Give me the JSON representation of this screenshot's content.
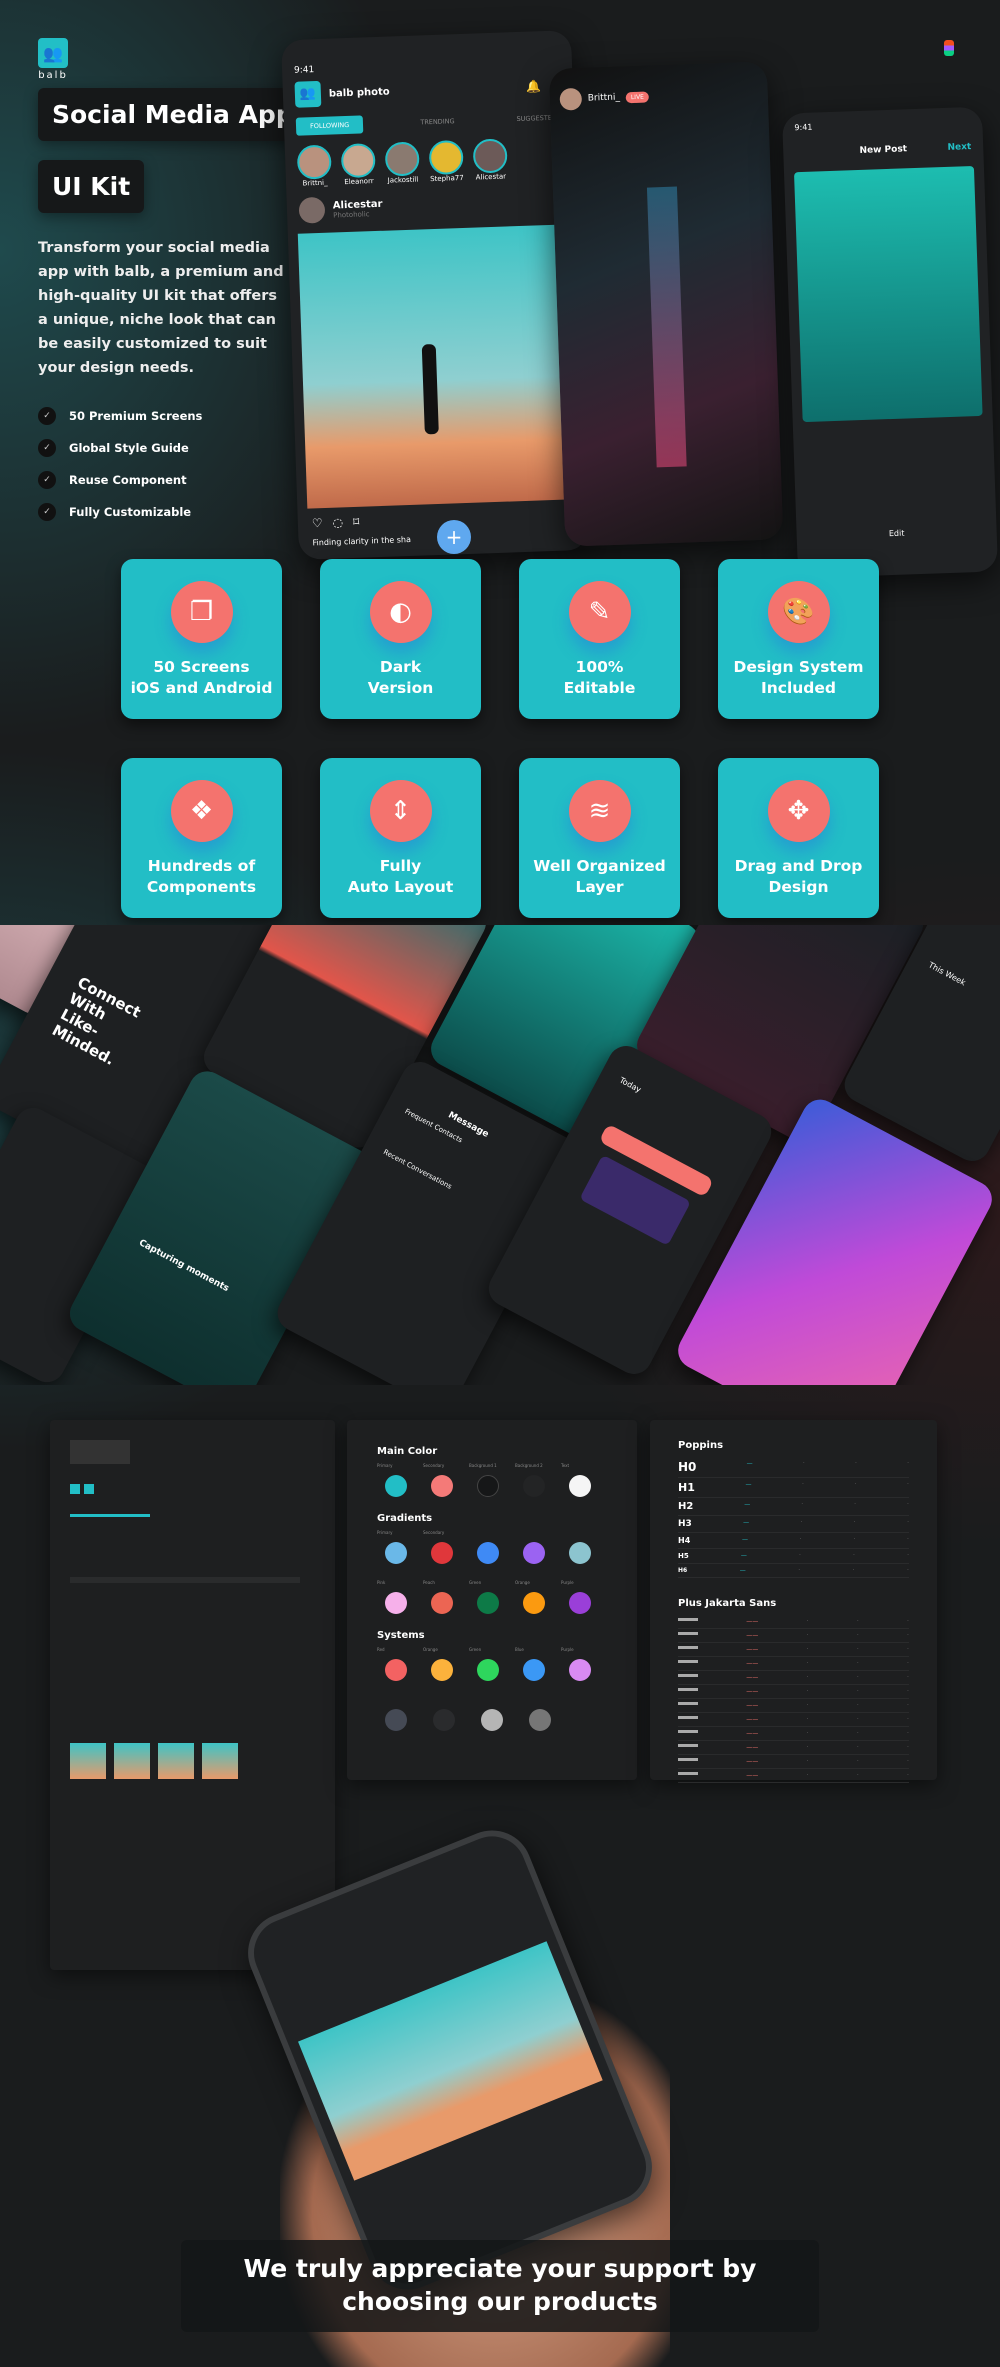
{
  "brand": {
    "name": "balb",
    "accent": "#22bec6",
    "secondary": "#f4736e"
  },
  "hero": {
    "title_line1": "Social Media App",
    "title_line2": "UI Kit",
    "description": "Transform your social media app with balb, a premium and high-quality UI kit that offers a unique, niche look that can be easily customized to suit your design needs.",
    "checklist": [
      "50 Premium Screens",
      "Global Style Guide",
      "Reuse Component",
      "Fully Customizable"
    ]
  },
  "phone_feed": {
    "time": "9:41",
    "app_name": "balb photo",
    "tabs": [
      "FOLLOWING",
      "TRENDING",
      "SUGGESTED"
    ],
    "stories": [
      "Brittni_",
      "Eleanorr",
      "Jackostill",
      "Stepha77",
      "Alicestar"
    ],
    "post_user": "Alicestar",
    "post_subtitle": "Photoholic",
    "caption": "Finding clarity in the sha"
  },
  "phone_live": {
    "user": "Brittni_",
    "live": "LIVE"
  },
  "phone_post": {
    "time": "9:41",
    "title": "New Post",
    "next": "Next",
    "edit": "Edit"
  },
  "features": [
    {
      "icon": "copy-icon",
      "label1": "50 Screens",
      "label2": "iOS and Android"
    },
    {
      "icon": "contrast-icon",
      "label1": "Dark",
      "label2": "Version"
    },
    {
      "icon": "edit-icon",
      "label1": "100%",
      "label2": "Editable"
    },
    {
      "icon": "palette-icon",
      "label1": "Design System",
      "label2": "Included"
    },
    {
      "icon": "components-icon",
      "label1": "Hundreds of",
      "label2": "Components"
    },
    {
      "icon": "auto-layout-icon",
      "label1": "Fully",
      "label2": "Auto Layout"
    },
    {
      "icon": "layers-icon",
      "label1": "Well Organized",
      "label2": "Layer"
    },
    {
      "icon": "move-icon",
      "label1": "Drag and Drop",
      "label2": "Design"
    }
  ],
  "collage": {
    "onboarding": "Connect With Like-Minded.",
    "camera_caption": "Capturing moments",
    "message_title": "Message",
    "frequent": "Frequent Contacts",
    "recent": "Recent Conversations",
    "today": "Today",
    "this_week": "This Week"
  },
  "style_guide": {
    "main_color": {
      "title": "Main Color",
      "swatches": [
        {
          "name": "Primary",
          "color": "#22bec6"
        },
        {
          "name": "Secondary",
          "color": "#f47a78"
        },
        {
          "name": "Background 1",
          "color": "#161718"
        },
        {
          "name": "Background 2",
          "color": "#232425"
        },
        {
          "name": "Text",
          "color": "#f5f5f5"
        }
      ]
    },
    "gradients": {
      "title": "Gradients",
      "swatches": [
        {
          "name": "Primary",
          "color": "#6ab8e8"
        },
        {
          "name": "Secondary",
          "color": "#e0373b"
        },
        {
          "name": "",
          "color": "#3f8af5"
        },
        {
          "name": "",
          "color": "#9b63f2"
        },
        {
          "name": "",
          "color": "#8cc4cf"
        },
        {
          "name": "Pink",
          "color": "#f6b0ea"
        },
        {
          "name": "Peach",
          "color": "#ec6553"
        },
        {
          "name": "Green",
          "color": "#0d7a47"
        },
        {
          "name": "Orange",
          "color": "#fb9a10"
        },
        {
          "name": "Purple",
          "color": "#9a3fd8"
        }
      ]
    },
    "systems": {
      "title": "Systems",
      "swatches": [
        {
          "name": "Red",
          "color": "#f36262"
        },
        {
          "name": "Orange",
          "color": "#fcb23c"
        },
        {
          "name": "Green",
          "color": "#2ed65d"
        },
        {
          "name": "Blue",
          "color": "#3b98f5"
        },
        {
          "name": "Purple",
          "color": "#d88af2"
        },
        {
          "name": "",
          "color": "#454a55"
        },
        {
          "name": "",
          "color": "#2a2b2d"
        },
        {
          "name": "",
          "color": "#b5b5b5"
        },
        {
          "name": "",
          "color": "#767676"
        }
      ]
    },
    "typography": [
      {
        "font": "Poppins",
        "styles": [
          "H0",
          "H1",
          "H2",
          "H3",
          "H4",
          "H5",
          "H6"
        ]
      },
      {
        "font": "Plus Jakarta Sans",
        "styles": []
      }
    ]
  },
  "footer": {
    "line1": "We truly appreciate your support by",
    "line2": "choosing our products"
  }
}
